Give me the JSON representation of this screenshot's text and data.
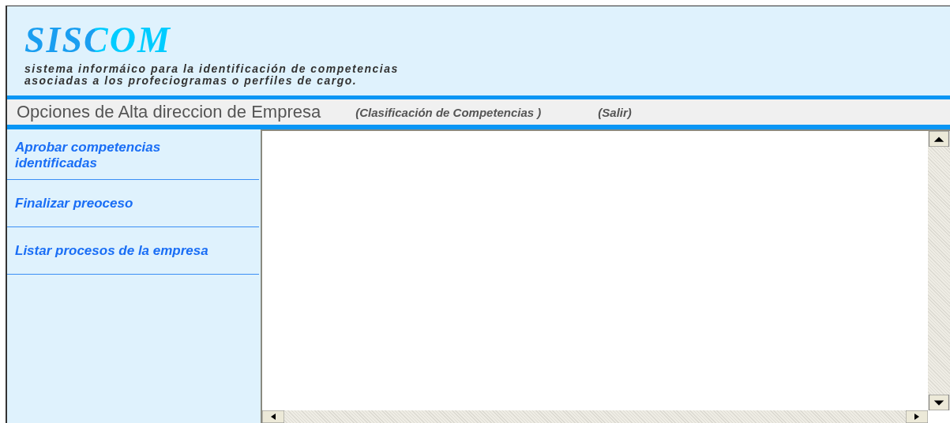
{
  "header": {
    "logo": "SISCOM",
    "subtitle_lines": [
      "sistema informáico para la identificación de competencias",
      "asociadas a los profeciogramas  o perfiles de cargo."
    ]
  },
  "options_bar": {
    "title": "Opciones de Alta direccion de Empresa",
    "section": "(Clasificación de Competencias )",
    "exit_link": "(Salir)"
  },
  "sidebar": {
    "items": [
      {
        "label": "Aprobar competencias identificadas"
      },
      {
        "label": "Finalizar preoceso"
      },
      {
        "label": "Listar procesos de la empresa"
      }
    ]
  }
}
